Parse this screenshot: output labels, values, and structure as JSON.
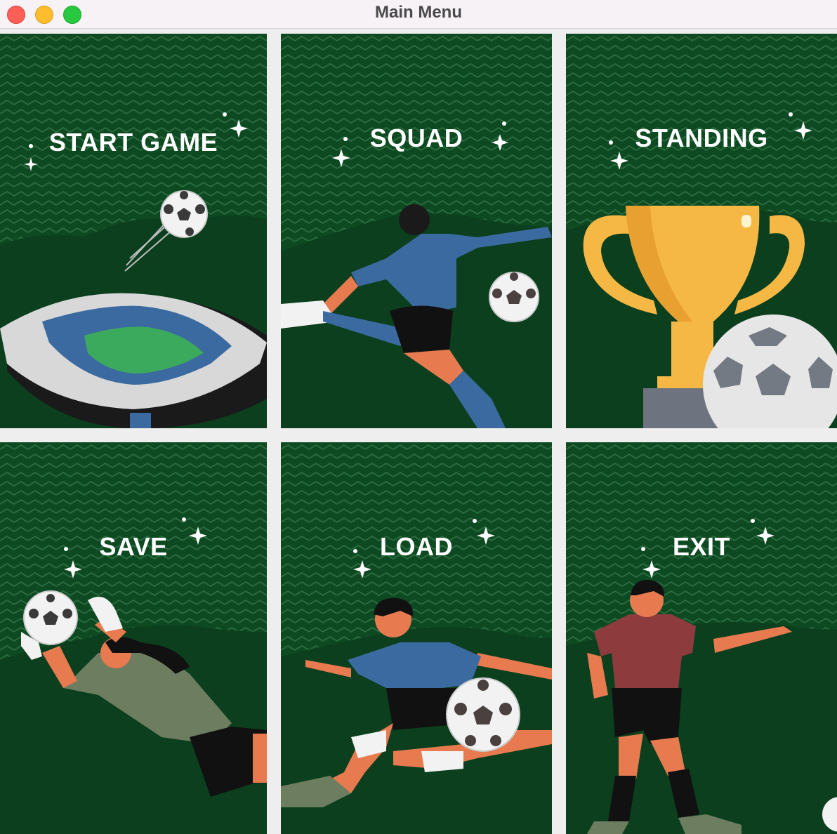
{
  "window": {
    "title": "Main Menu"
  },
  "menu": {
    "start_game": "START GAME",
    "squad": "SQUAD",
    "standing": "STANDING",
    "save": "SAVE",
    "load": "LOAD",
    "exit": "EXIT"
  },
  "colors": {
    "field_green": "#0d4a22",
    "hill_green": "#0b3f1d",
    "zigzag": "#2a6b3e",
    "trophy_gold": "#f6b845",
    "jersey_blue": "#3b6aa0",
    "jersey_red": "#8e3b3e",
    "jersey_olive": "#6d7d5f"
  },
  "icons": {
    "close": "close-icon",
    "minimize": "minimize-icon",
    "zoom": "zoom-icon"
  }
}
